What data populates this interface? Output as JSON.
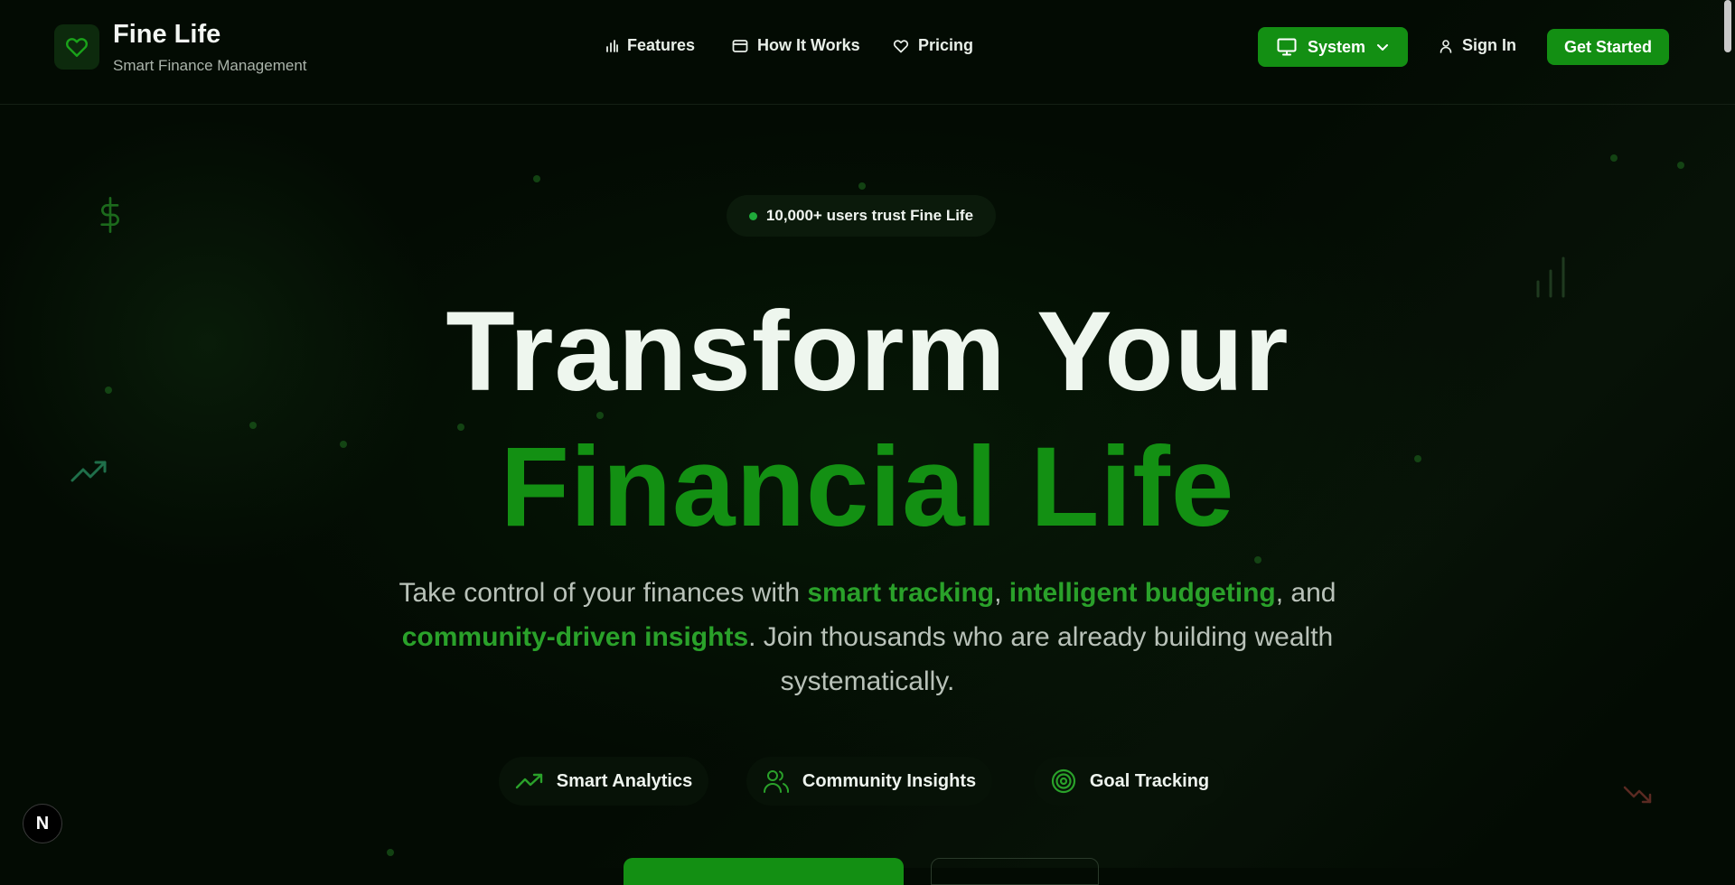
{
  "brand": {
    "name": "Fine Life",
    "tagline": "Smart Finance Management"
  },
  "nav": {
    "items": [
      {
        "label": "Features",
        "icon": "bar-chart-icon"
      },
      {
        "label": "How It Works",
        "icon": "wallet-icon"
      },
      {
        "label": "Pricing",
        "icon": "heart-icon"
      }
    ]
  },
  "header": {
    "theme_label": "System",
    "signin_label": "Sign In",
    "get_started_label": "Get Started"
  },
  "hero": {
    "badge": "10,000+ users trust Fine Life",
    "title_line1": "Transform Your",
    "title_line2": "Financial Life",
    "subtitle": {
      "p1": "Take control of your finances with ",
      "h1": "smart tracking",
      "p2": ", ",
      "h2": "intelligent budgeting",
      "p3": ", and ",
      "h3": "community-driven insights",
      "p4": ". Join thousands who are already building wealth systematically."
    },
    "features": [
      {
        "label": "Smart Analytics",
        "icon": "trending-up-icon"
      },
      {
        "label": "Community Insights",
        "icon": "users-icon"
      },
      {
        "label": "Goal Tracking",
        "icon": "target-icon"
      }
    ]
  },
  "dev_badge": "N",
  "colors": {
    "accent": "#138f13",
    "background": "#030b03",
    "highlight": "#2aa12a"
  }
}
